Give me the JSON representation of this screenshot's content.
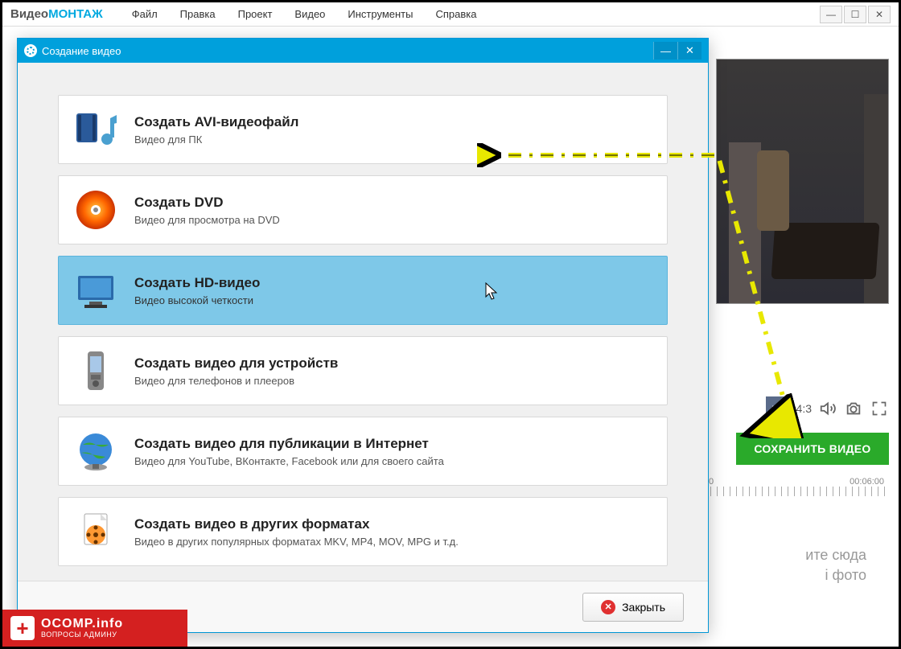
{
  "brand": {
    "part1": "Видео",
    "part2": "МОНТАЖ"
  },
  "menu": [
    "Файл",
    "Правка",
    "Проект",
    "Видео",
    "Инструменты",
    "Справка"
  ],
  "player": {
    "aspect": "4:3"
  },
  "save_button": "СОХРАНИТЬ ВИДЕО",
  "timeline": {
    "marks": [
      "0",
      "00:06:00"
    ]
  },
  "drop_hint": {
    "line1": "ите сюда",
    "line2": "і фото"
  },
  "dialog": {
    "title": "Создание видео",
    "options": [
      {
        "title": "Создать AVI-видеофайл",
        "sub": "Видео для ПК",
        "icon": "film-music"
      },
      {
        "title": "Создать DVD",
        "sub": "Видео для просмотра на DVD",
        "icon": "dvd"
      },
      {
        "title": "Создать HD-видео",
        "sub": "Видео высокой четкости",
        "icon": "monitor",
        "selected": true
      },
      {
        "title": "Создать видео для устройств",
        "sub": "Видео для телефонов и плееров",
        "icon": "phone"
      },
      {
        "title": "Создать видео для публикации в Интернет",
        "sub": "Видео для YouTube, ВКонтакте, Facebook или для своего сайта",
        "icon": "globe"
      },
      {
        "title": "Создать видео в других форматах",
        "sub": "Видео в других популярных форматах MKV, MP4, MOV, MPG и т.д.",
        "icon": "filereel"
      }
    ],
    "close_label": "Закрыть"
  },
  "watermark": {
    "line1": "OCOMP.info",
    "line2": "ВОПРОСЫ АДМИНУ"
  }
}
